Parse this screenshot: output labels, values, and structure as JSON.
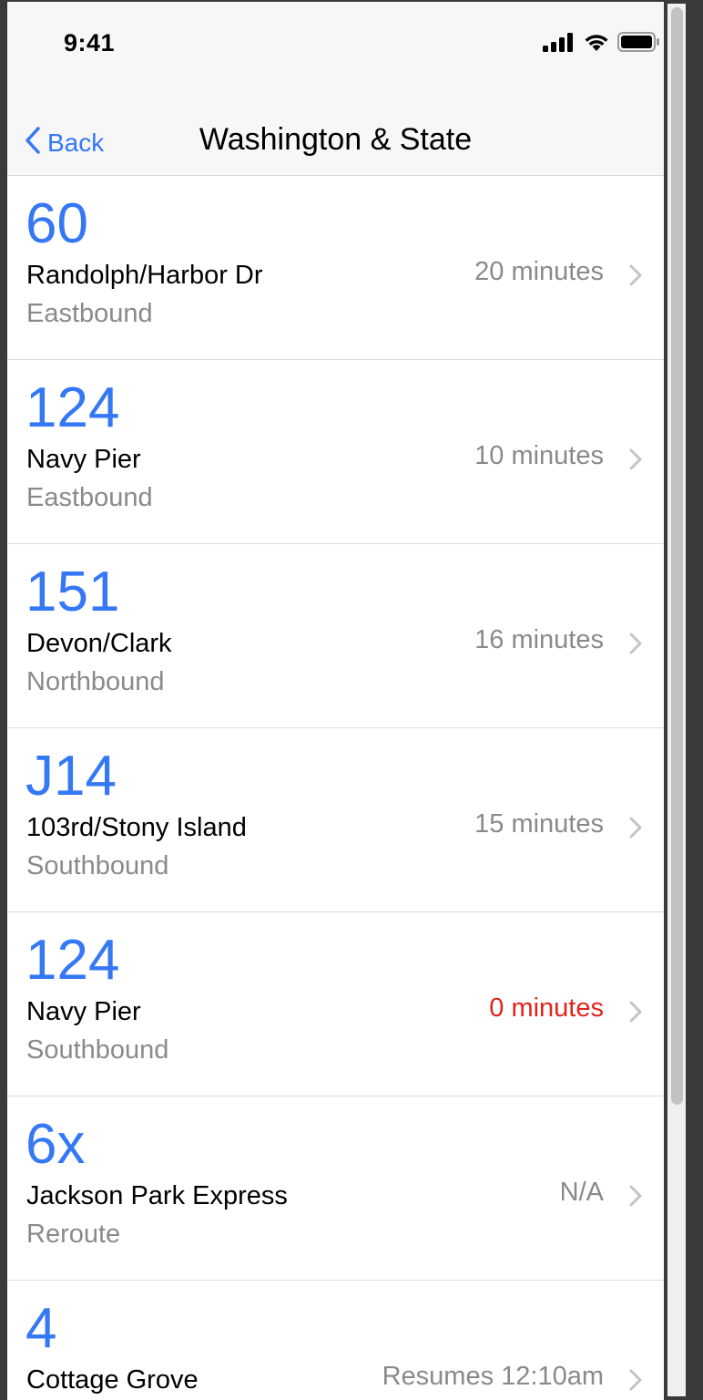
{
  "status_bar": {
    "time": "9:41",
    "icons": [
      "cellular-signal-icon",
      "wifi-icon",
      "battery-icon"
    ]
  },
  "nav": {
    "back_label": "Back",
    "title": "Washington & State"
  },
  "colors": {
    "accent": "#3478f6",
    "secondary_text": "#8a8a8e",
    "alert": "#e0251b"
  },
  "routes": [
    {
      "number": "60",
      "destination": "Randolph/Harbor Dr",
      "direction": "Eastbound",
      "eta": "20 minutes",
      "eta_status": "normal"
    },
    {
      "number": "124",
      "destination": "Navy Pier",
      "direction": "Eastbound",
      "eta": "10 minutes",
      "eta_status": "normal"
    },
    {
      "number": "151",
      "destination": "Devon/Clark",
      "direction": "Northbound",
      "eta": "16 minutes",
      "eta_status": "normal"
    },
    {
      "number": "J14",
      "destination": "103rd/Stony Island",
      "direction": "Southbound",
      "eta": "15 minutes",
      "eta_status": "normal"
    },
    {
      "number": "124",
      "destination": "Navy Pier",
      "direction": "Southbound",
      "eta": "0 minutes",
      "eta_status": "alert"
    },
    {
      "number": "6x",
      "destination": "Jackson Park Express",
      "direction": "Reroute",
      "eta": "N/A",
      "eta_status": "normal"
    },
    {
      "number": "4",
      "destination": "Cottage Grove",
      "direction": "",
      "eta": "Resumes 12:10am",
      "eta_status": "normal"
    }
  ]
}
